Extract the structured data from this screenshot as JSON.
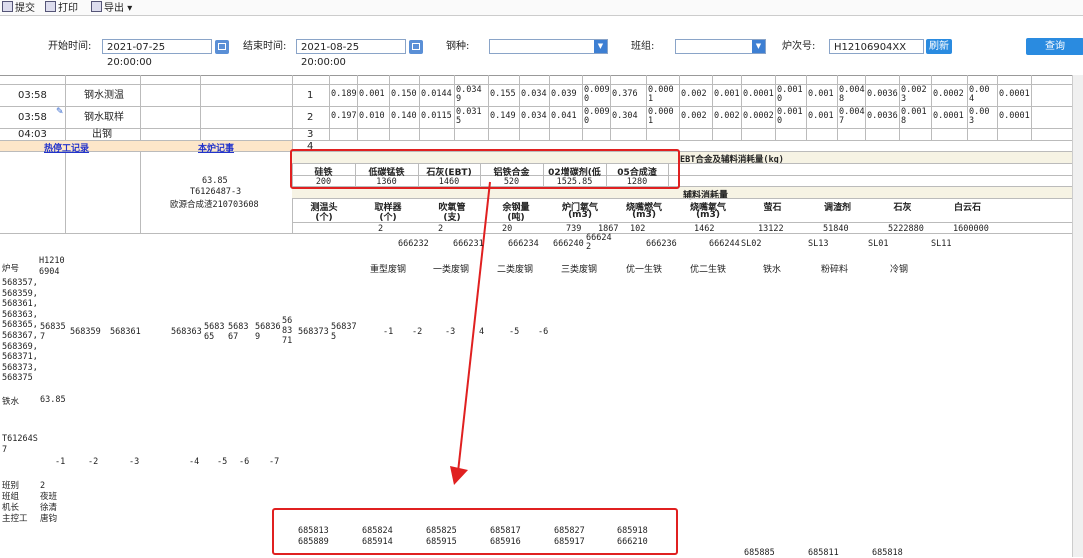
{
  "toolbar": {
    "submit": "提交",
    "print": "打印",
    "export": "导出",
    "export_caret": "▾"
  },
  "filters": {
    "start_label": "开始时间:",
    "start_value": "2021-07-25 20:00:00",
    "end_label": "结束时间:",
    "end_value": "2021-08-25 20:00:00",
    "steel_label": "钢种:",
    "steel_value": "",
    "team_label": "班组:",
    "team_value": "",
    "furnace_label": "炉次号:",
    "furnace_value": "H12106904XX",
    "refresh": "刷新",
    "query": "查询"
  },
  "process_rows": [
    {
      "time": "03:58",
      "op": "钢水测温",
      "seq": "1",
      "vals": [
        "0.189",
        "0.001",
        "0.150",
        "0.0144",
        "0.034\n9",
        "0.155",
        "0.034",
        "0.039",
        "0.009\n0",
        "0.376",
        "0.000\n1",
        "0.002",
        "0.001",
        "0.0001",
        "0.001\n0",
        "0.001",
        "0.004\n8",
        "0.0036",
        "0.002\n3",
        "0.0002",
        "0.00\n4",
        "0.0001"
      ]
    },
    {
      "time": "03:58",
      "op": "钢水取样",
      "seq": "2",
      "vals": [
        "0.197",
        "0.010",
        "0.140",
        "0.0115",
        "0.031\n5",
        "0.149",
        "0.034",
        "0.041",
        "0.009\n0",
        "0.304",
        "0.000\n1",
        "0.002",
        "0.002",
        "0.0002",
        "0.001\n0",
        "0.001",
        "0.004\n7",
        "0.0036",
        "0.001\n8",
        "0.0001",
        "0.00\n3",
        "0.0001"
      ]
    },
    {
      "time": "04:03",
      "op": "出钢",
      "seq": "3",
      "vals": []
    },
    {
      "time": "",
      "op": "",
      "seq": "4",
      "vals": []
    }
  ],
  "sections": {
    "hot_stop": "热停工记录",
    "this_furnace": "本炉记事",
    "memo_line1": "63.85",
    "memo_line2": "T6126487-3",
    "memo_line3": "欧源合成渣210703608",
    "alloy_title": "EBT合金及辅料消耗量(kg)",
    "aux_title": "辅料消耗量"
  },
  "alloy": {
    "headers": [
      "硅铁",
      "低碳锰铁",
      "石灰(EBT)",
      "铝铁合金",
      "02增碳剂(低",
      "05合成渣"
    ],
    "values": [
      "200",
      "1360",
      "1460",
      "520",
      "1525.85",
      "1280"
    ]
  },
  "aux": {
    "headers": [
      [
        "测温头",
        "(个)"
      ],
      [
        "取样器",
        "(个)"
      ],
      [
        "吹氧管",
        "(支)"
      ],
      [
        "余钢量",
        "(吨)"
      ],
      [
        "炉门氧气",
        "(m3)"
      ],
      [
        "烧嘴燃气",
        "(m3)"
      ],
      [
        "烧嘴氧气",
        "(m3)"
      ],
      [
        "萤石",
        ""
      ],
      [
        "调渣剂",
        ""
      ],
      [
        "石灰",
        ""
      ],
      [
        "白云石",
        ""
      ]
    ],
    "values": [
      "",
      "2",
      "2",
      "20",
      "739",
      "1867",
      "102",
      "1462",
      "13122",
      "51840",
      "5222880",
      "1600000"
    ]
  },
  "raw": {
    "codes_row": [
      "666232",
      "666231",
      "666234",
      "666240",
      "66624\n2",
      "666236",
      "666244",
      "SL02",
      "SL13",
      "SL01",
      "SL11"
    ],
    "furnace_label": "炉号",
    "furnace_code": "H1210\n6904",
    "scrap_labels": [
      "重型废钢",
      "一类废钢",
      "二类废钢",
      "三类废钢",
      "优一生铁",
      "优二生铁",
      "铁水",
      "粉碎料",
      "冷钢"
    ],
    "furnace_list": "568357,\n568359,\n568361,\n568363,\n568365,\n568367,\n568369,\n568371,\n568373,\n568375",
    "furnace_nums": [
      "56835\n7",
      "568359",
      "568361",
      "568363",
      "5683\n65",
      "5683\n67",
      "56836\n9",
      "56\n83\n71",
      "568373",
      "56837\n5"
    ],
    "neg_row1": [
      "-1",
      "-2",
      "-3",
      "4",
      "-5",
      "-6"
    ],
    "iron_label": "铁水",
    "iron_value": "63.85",
    "t_code": "T61264S\n7",
    "neg_row2": [
      "-1",
      "-2",
      "-3",
      "-4",
      "-5",
      "-6",
      "-7"
    ],
    "shift_labels": "班别\n班组\n机长\n主控工",
    "shift_values": "2\n夜班\n徐清\n唐钧",
    "box_row1": [
      "685813",
      "685824",
      "685825",
      "685817",
      "685827",
      "685918"
    ],
    "box_row2": [
      "685889",
      "685914",
      "685915",
      "685916",
      "685917",
      "666210"
    ],
    "bottom_codes": [
      "685885",
      "685811",
      "685818"
    ]
  },
  "colors": {
    "highlight": "#e02020",
    "accent": "#2a8be0"
  }
}
